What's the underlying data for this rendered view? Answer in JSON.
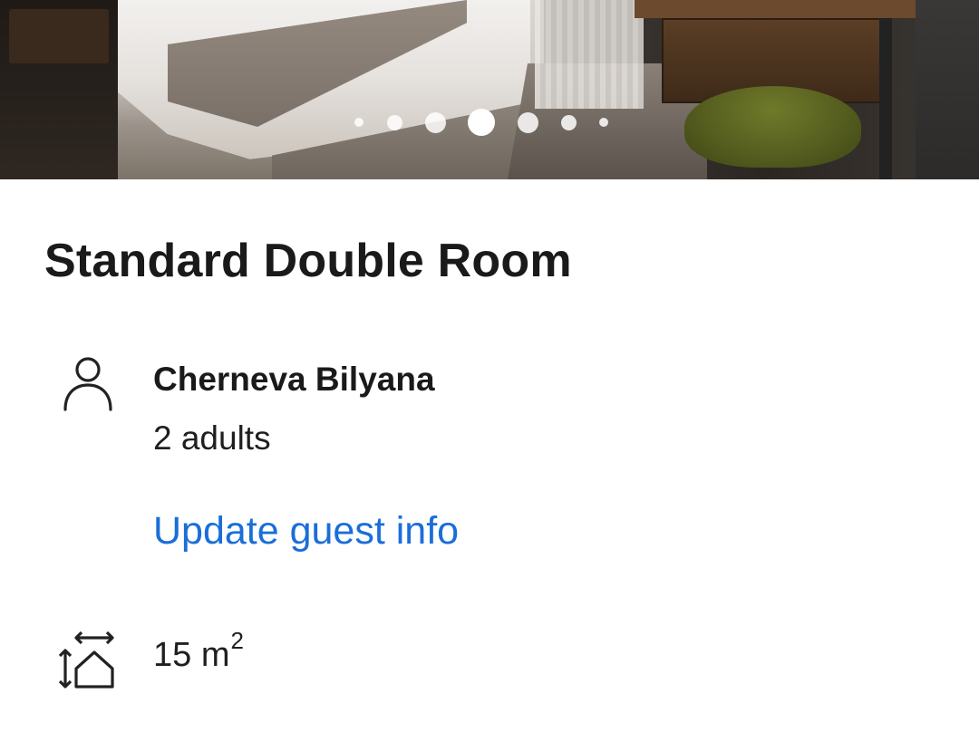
{
  "gallery": {
    "dot_count": 7,
    "active_index": 3
  },
  "room": {
    "title": "Standard Double Room",
    "size_value": "15 m",
    "size_unit_exponent": "2"
  },
  "guest": {
    "name": "Cherneva Bilyana",
    "count": "2 adults",
    "update_link": "Update guest info"
  },
  "icons": {
    "guest": "person-icon",
    "size": "room-size-icon"
  },
  "colors": {
    "link": "#1a6ed8",
    "text": "#1a1a1a"
  }
}
